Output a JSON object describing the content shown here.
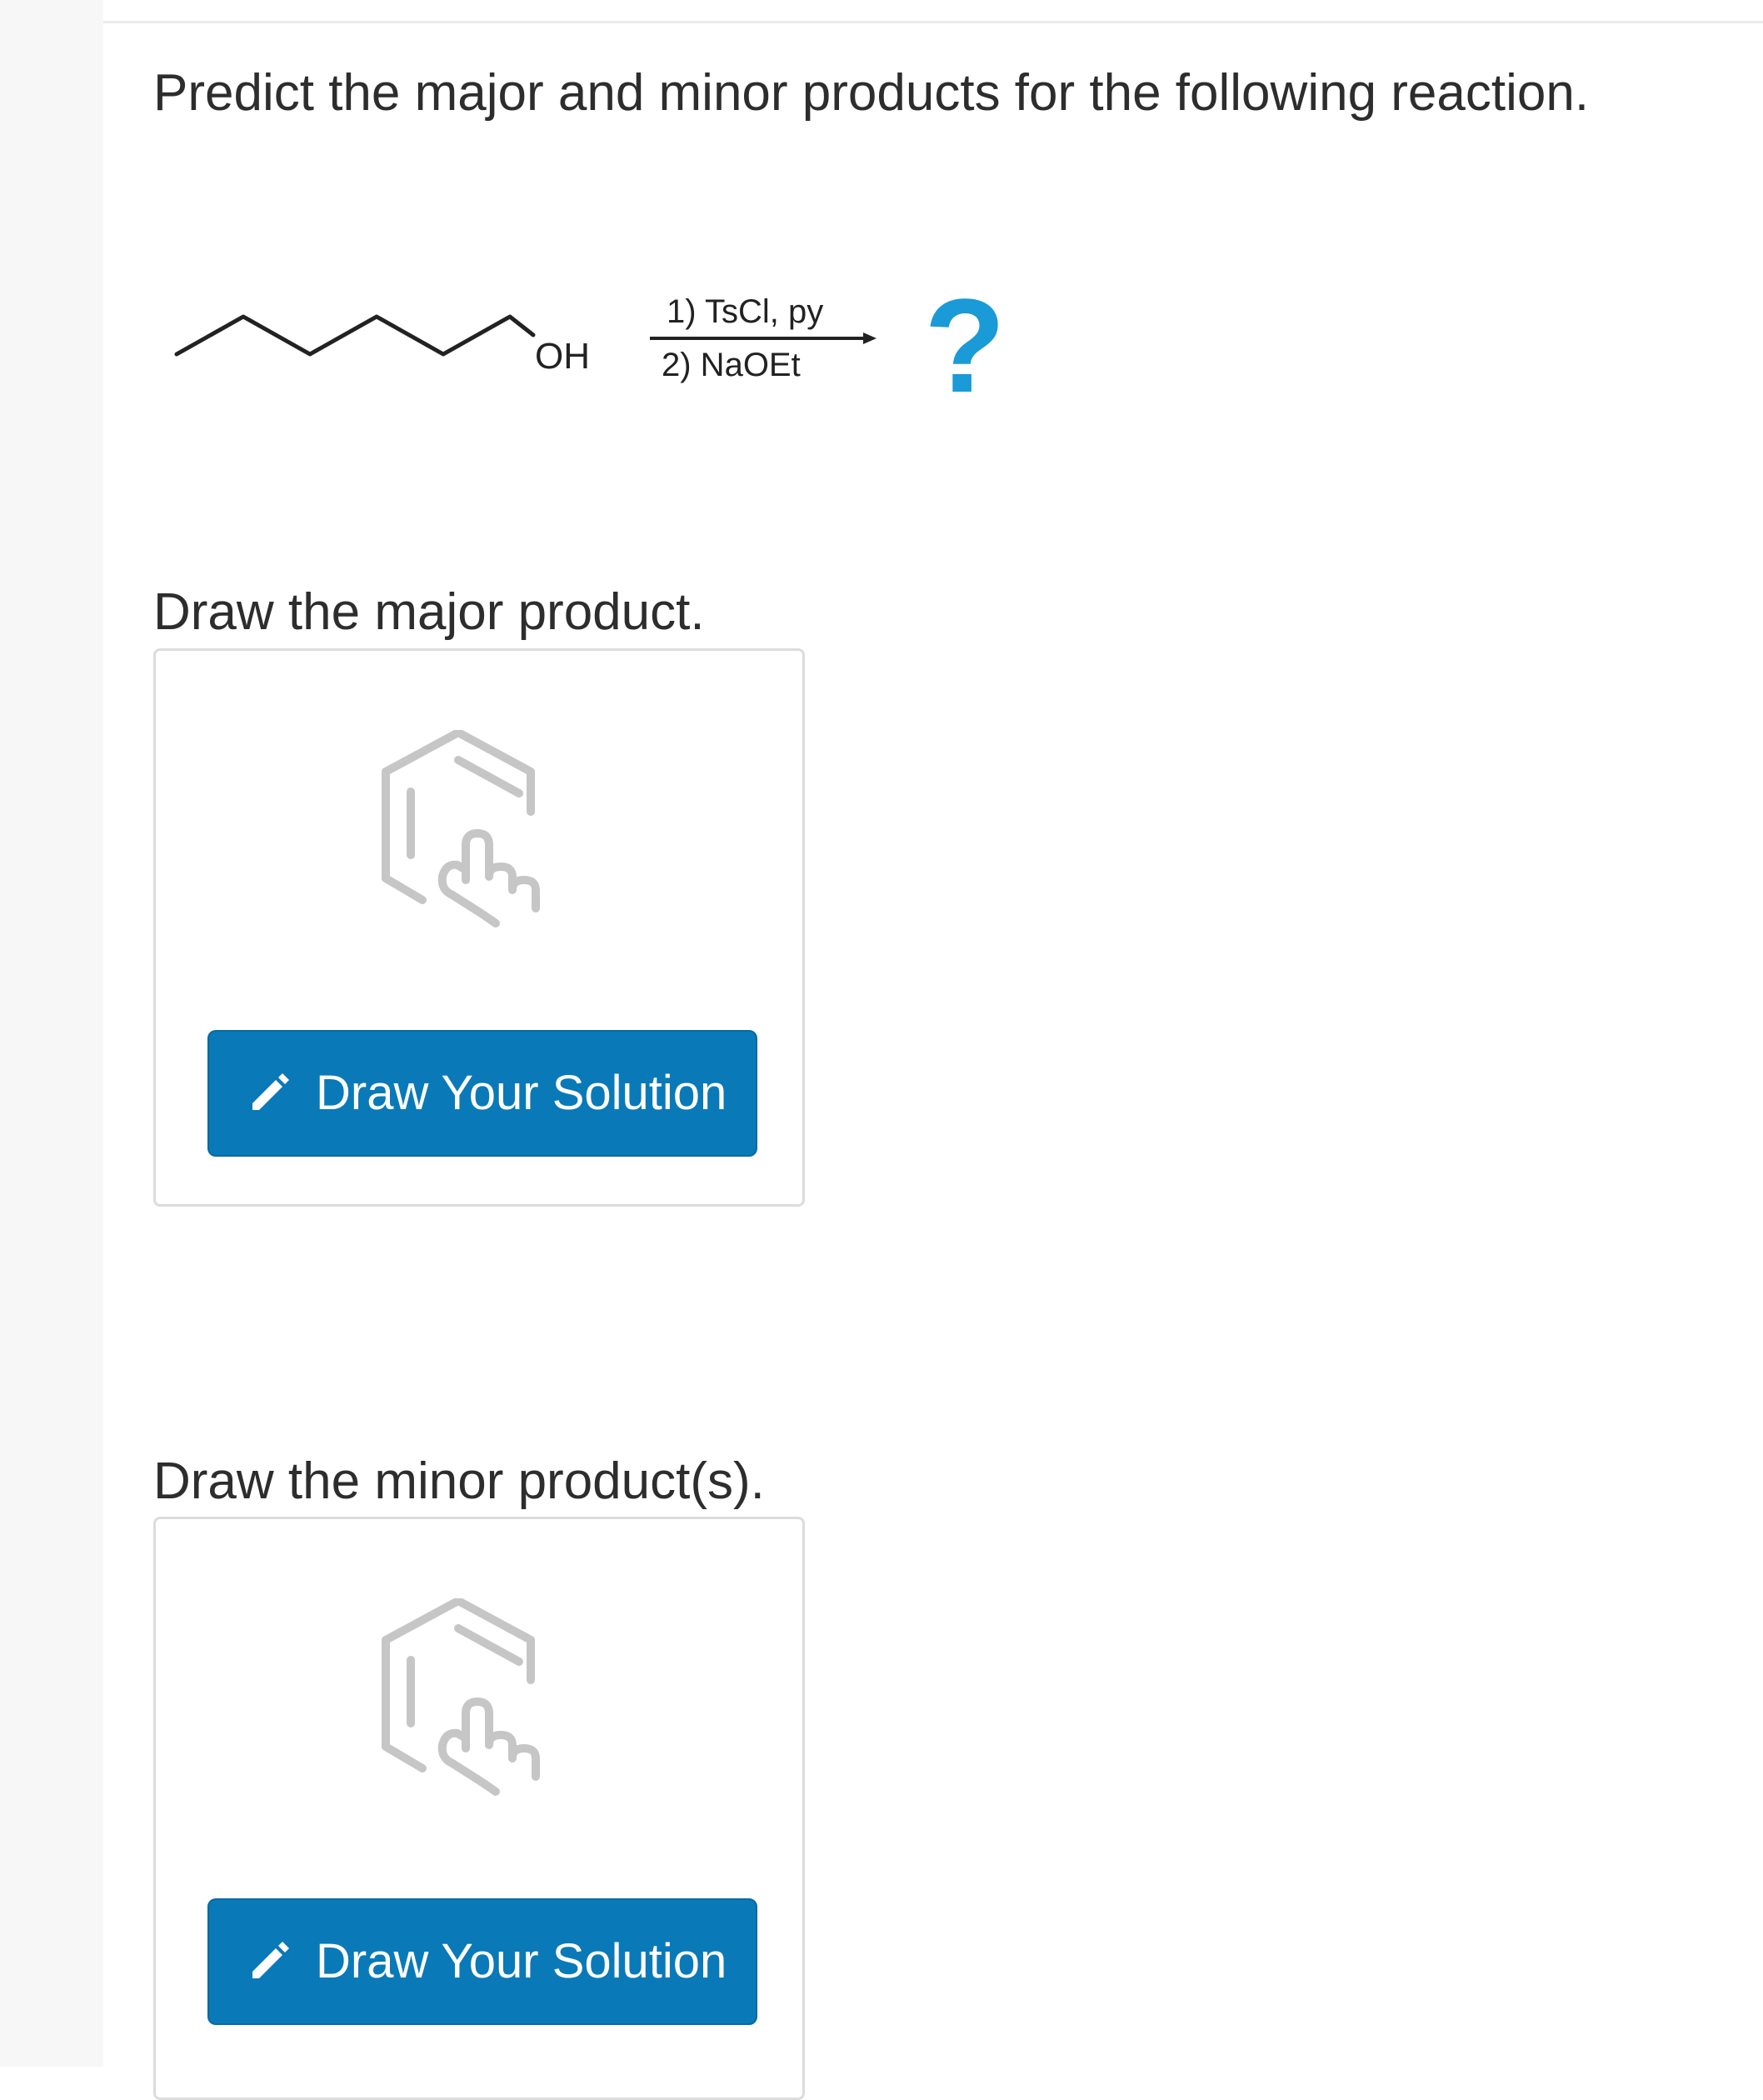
{
  "question": "Predict the major and minor products for the following reaction.",
  "reaction": {
    "leaving_group_label": "OH",
    "reagent_step_1": "1) TsCl, py",
    "reagent_step_2": "2) NaOEt",
    "product_placeholder": "?",
    "product_placeholder_color": "#1a9ad6"
  },
  "major_section": {
    "title": "Draw the major product.",
    "button_label": "Draw Your Solution",
    "illustration_icon": "draw-structure-icon",
    "button_icon": "pencil-icon"
  },
  "minor_section": {
    "title": "Draw the minor product(s).",
    "button_label": "Draw Your Solution",
    "illustration_icon": "draw-structure-icon",
    "button_icon": "pencil-icon"
  },
  "colors": {
    "button_background": "#0a79b8",
    "text": "#2d2d2d",
    "box_border": "#dcdcdc",
    "illustration": "#c6c6c6"
  }
}
